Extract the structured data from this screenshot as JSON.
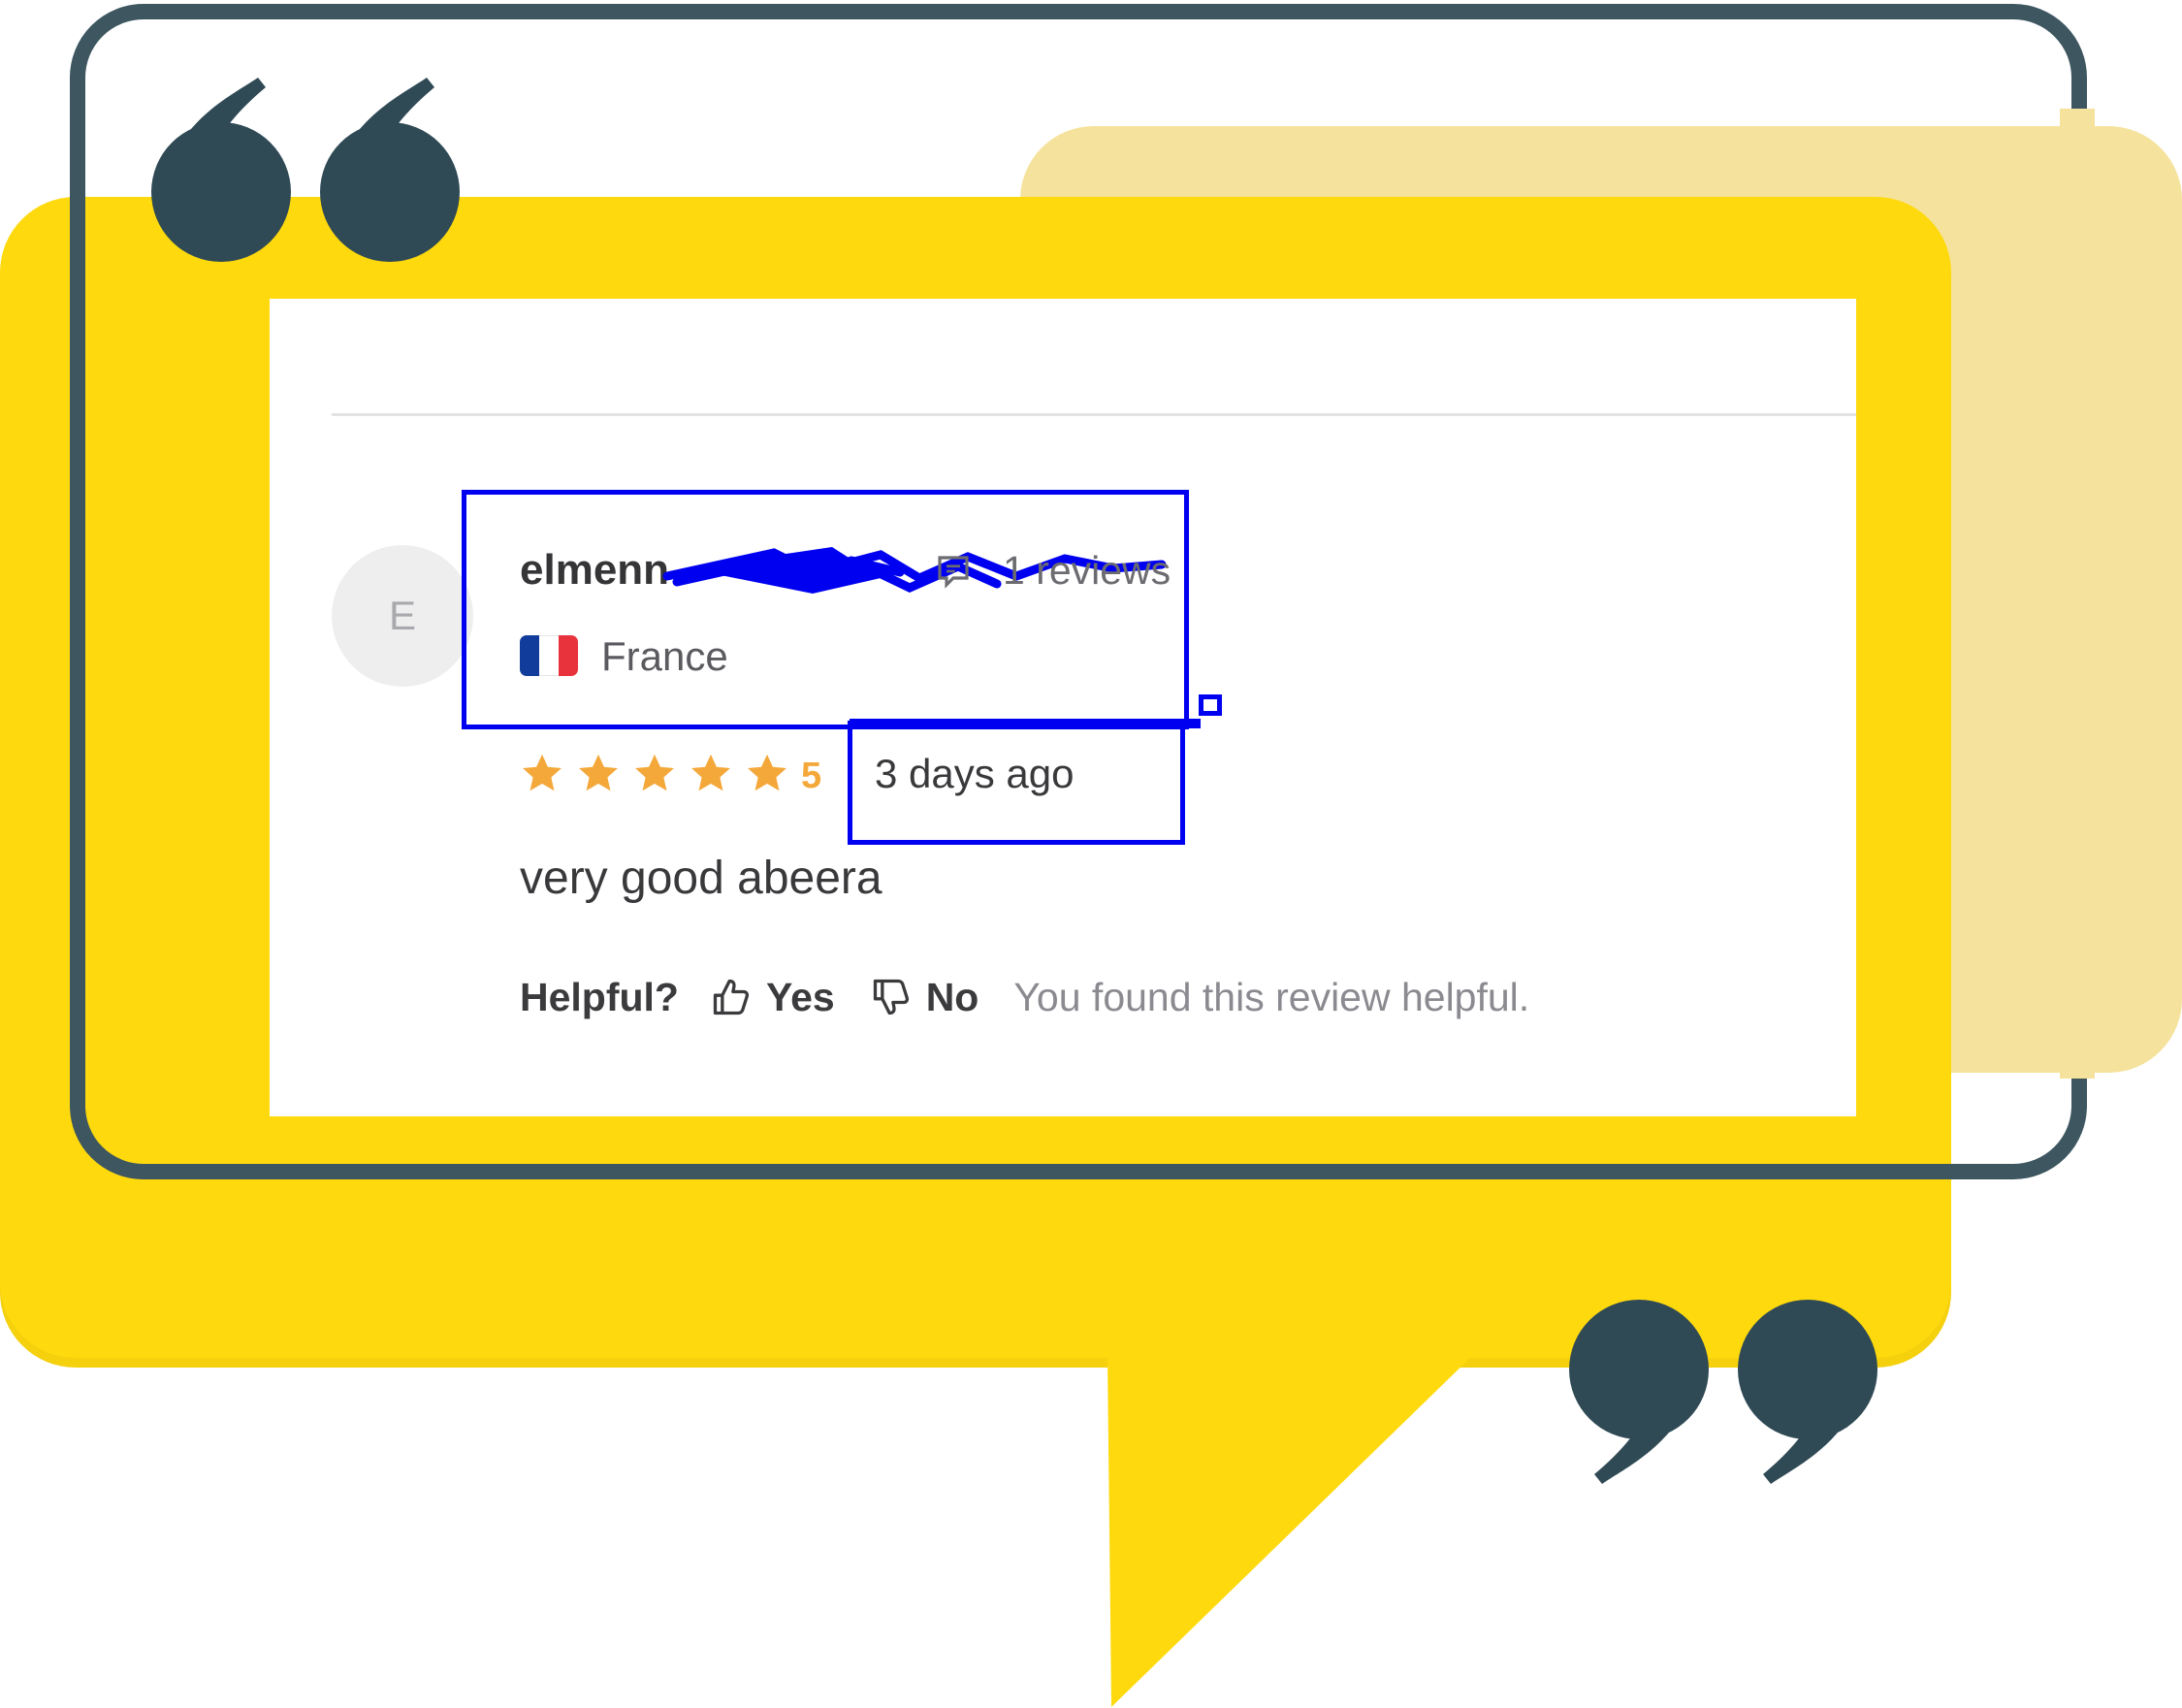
{
  "review": {
    "avatar_initial": "E",
    "username": "elmenn",
    "review_count": "1 reviews",
    "country": "France",
    "flag_colors": [
      "#123c9c",
      "#ffffff",
      "#e8333d"
    ],
    "rating": "5",
    "stars_filled": 5,
    "star_color": "#f4a83a",
    "date": "3 days ago",
    "text": "very good abeera"
  },
  "helpful": {
    "label": "Helpful?",
    "yes_label": "Yes",
    "no_label": "No",
    "note": "You found this review helpful."
  },
  "colors": {
    "bubble_yellow": "#fed90e",
    "back_card": "#f5e29c",
    "frame_and_quotes": "#3d5660",
    "annotation_blue": "#0000f0"
  },
  "icons": [
    "open-quote-icon",
    "close-quote-icon",
    "review-count-icon",
    "france-flag-icon",
    "star-icon",
    "thumbs-up-icon",
    "thumbs-down-icon"
  ]
}
